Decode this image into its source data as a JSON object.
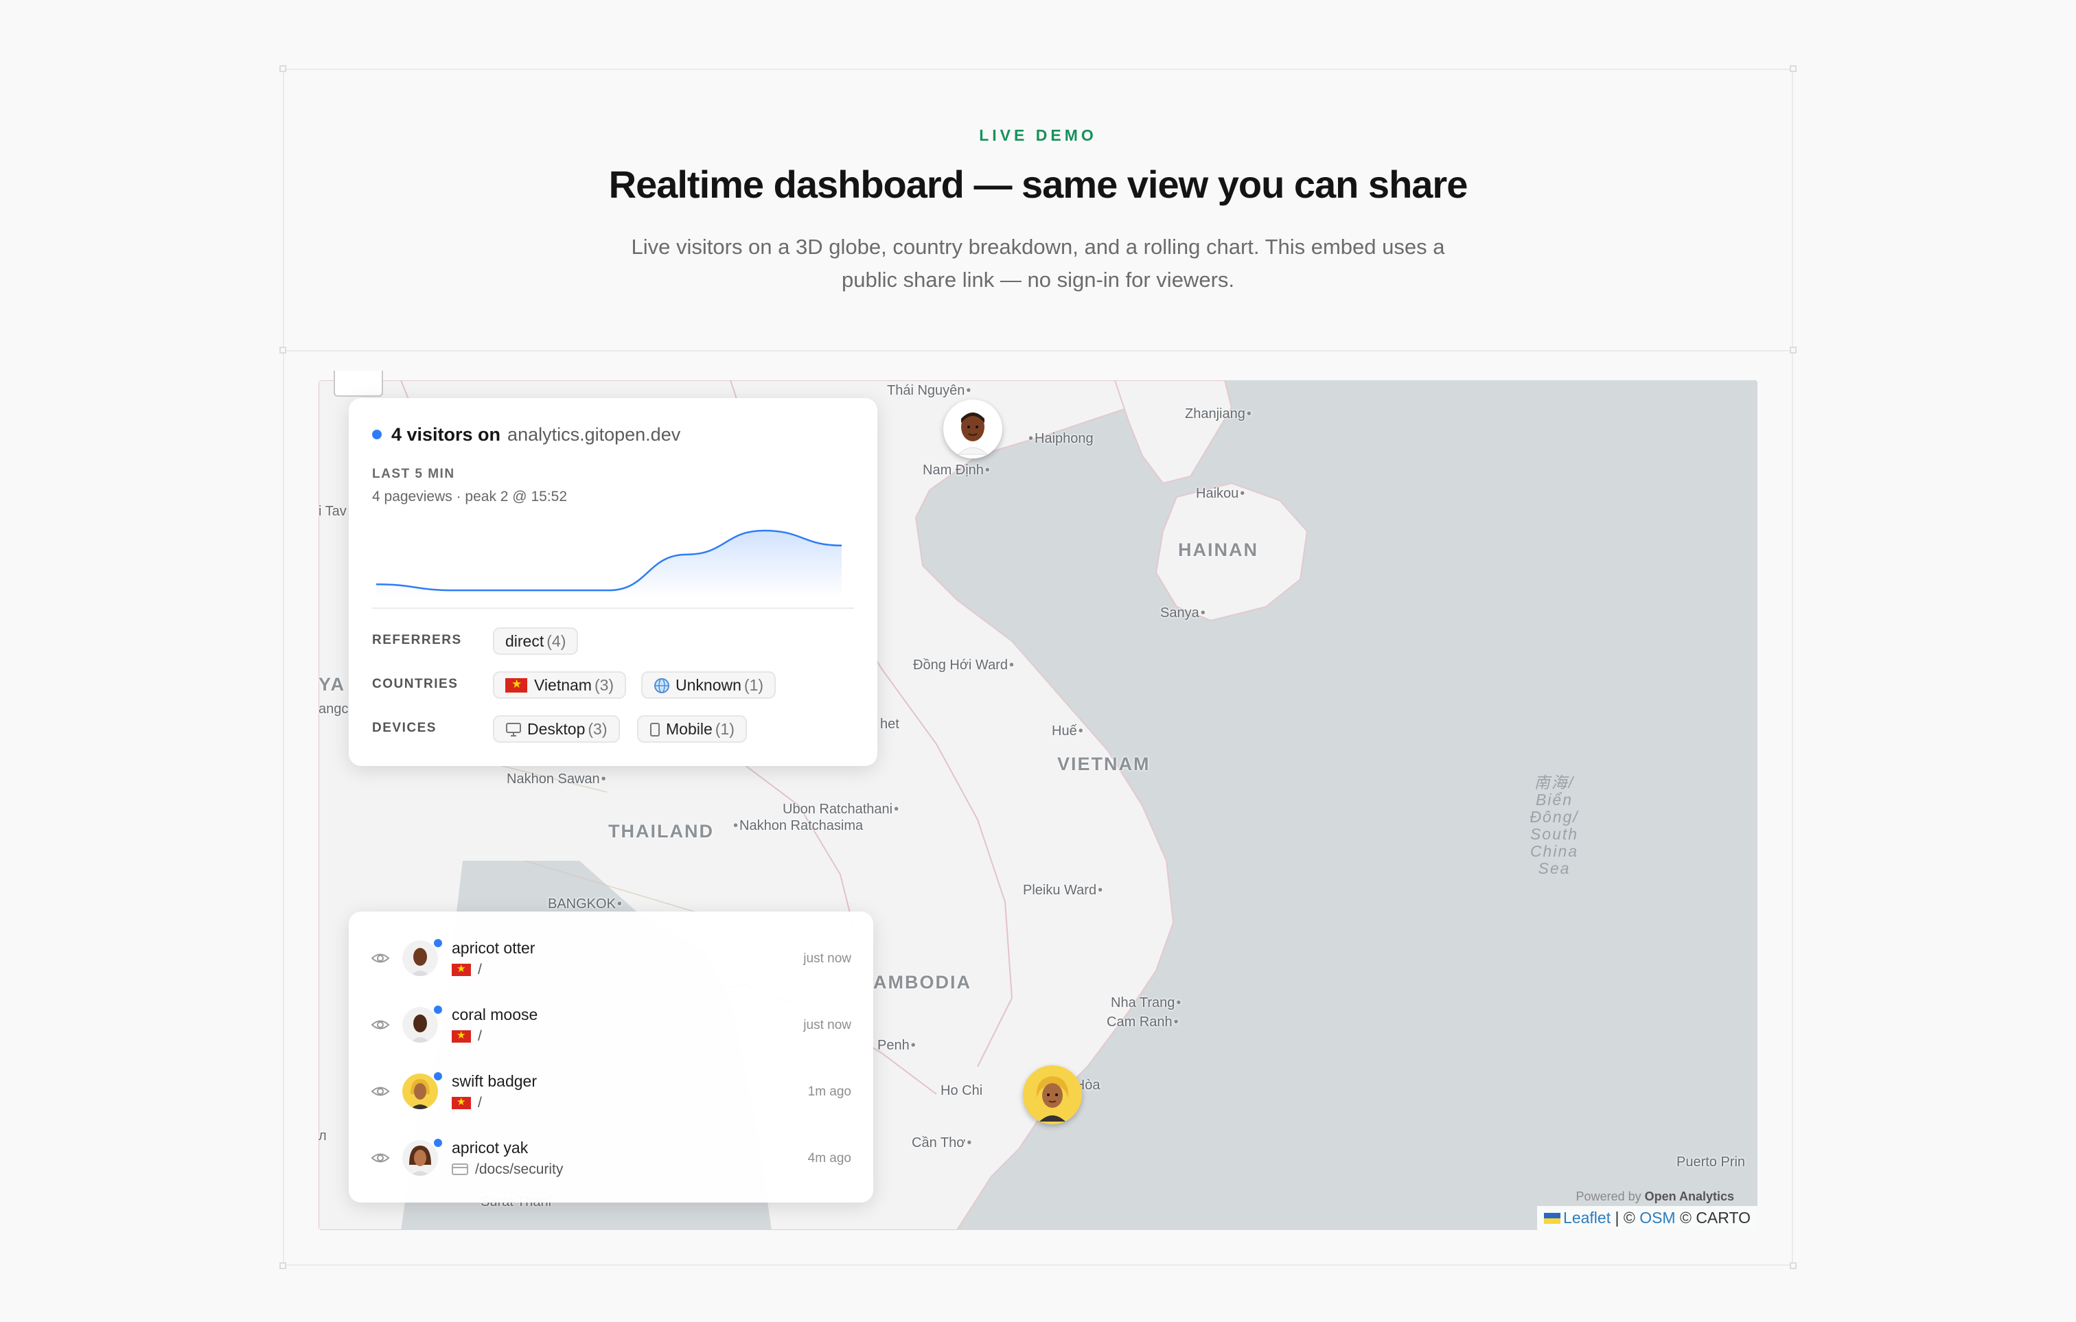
{
  "header": {
    "eyebrow": "LIVE DEMO",
    "title": "Realtime dashboard — same view you can share",
    "subtitle": "Live visitors on a 3D globe, country breakdown, and a rolling chart. This embed uses a public share link — no sign-in for viewers."
  },
  "stats_card": {
    "visitors_count": "4 visitors on",
    "domain": "analytics.gitopen.dev",
    "window_label": "LAST 5 MIN",
    "window_meta": "4 pageviews · peak 2 @ 15:52",
    "referrers_label": "REFERRERS",
    "countries_label": "COUNTRIES",
    "devices_label": "DEVICES",
    "referrers": [
      {
        "label": "direct",
        "count": "(4)"
      }
    ],
    "countries": [
      {
        "label": "Vietnam",
        "count": "(3)",
        "icon": "vietnam-flag-icon"
      },
      {
        "label": "Unknown",
        "count": "(1)",
        "icon": "globe-icon"
      }
    ],
    "devices": [
      {
        "label": "Desktop",
        "count": "(3)",
        "icon": "desktop-icon"
      },
      {
        "label": "Mobile",
        "count": "(1)",
        "icon": "mobile-icon"
      }
    ],
    "accent_color": "#2f7df6"
  },
  "chart_data": {
    "type": "area",
    "x": [
      1,
      2,
      3,
      4,
      5,
      6,
      7
    ],
    "values": [
      0.2,
      0,
      0,
      0,
      1.2,
      2,
      1.5
    ],
    "title": "",
    "xlabel": "",
    "ylabel": "",
    "ylim": [
      0,
      2.3
    ],
    "grid": false,
    "color": "#2f7df6"
  },
  "visitors": [
    {
      "name": "apricot otter",
      "path": "/",
      "time": "just now",
      "source": "vietnam-flag-icon"
    },
    {
      "name": "coral moose",
      "path": "/",
      "time": "just now",
      "source": "vietnam-flag-icon"
    },
    {
      "name": "swift badger",
      "path": "/",
      "time": "1m ago",
      "source": "vietnam-flag-icon"
    },
    {
      "name": "apricot yak",
      "path": "/docs/security",
      "time": "4m ago",
      "source": "page-icon"
    }
  ],
  "map": {
    "labels": {
      "thai_nguyen": "Thái Nguyên",
      "haiphong": "Haiphong",
      "nam_dinh": "Nam Định",
      "zhanjiang": "Zhanjiang",
      "haikou": "Haikou",
      "hainan": "HAINAN",
      "sanya": "Sanya",
      "dong_hoi": "Đồng Hới Ward",
      "hue": "Huế",
      "vietnam": "VIETNAM",
      "nakhon_sawan": "Nakhon Sawan",
      "ubon": "Ubon Ratchathani",
      "nakhon_ratchasima": "Nakhon Ratchasima",
      "thailand": "THAILAND",
      "bangkok": "BANGKOK",
      "pleiku": "Pleiku Ward",
      "cambodia": "AMBODIA",
      "nha_trang": "Nha Trang",
      "cam_ranh": "Cam Ranh",
      "phnom_penh": "Penh",
      "ho_chi_minh": "Ho Chi",
      "bien_hoa": "ên Hòa",
      "can_tho": "Cần Thơ",
      "surat": "Surat Thani",
      "puerto": "Puerto Prin",
      "sea": "南海/\nBiển\nĐông/\nSouth\nChina\nSea",
      "left_tav": "i Tav",
      "left_ya": "YA",
      "left_ango": "angc",
      "left_het": "het",
      "left_n": "л"
    },
    "powered_prefix": "Powered by",
    "powered_brand": "Open Analytics",
    "attr_leaflet": "Leaflet",
    "attr_sep": "| ©",
    "attr_osm": "OSM",
    "attr_carto": "© CARTO"
  }
}
